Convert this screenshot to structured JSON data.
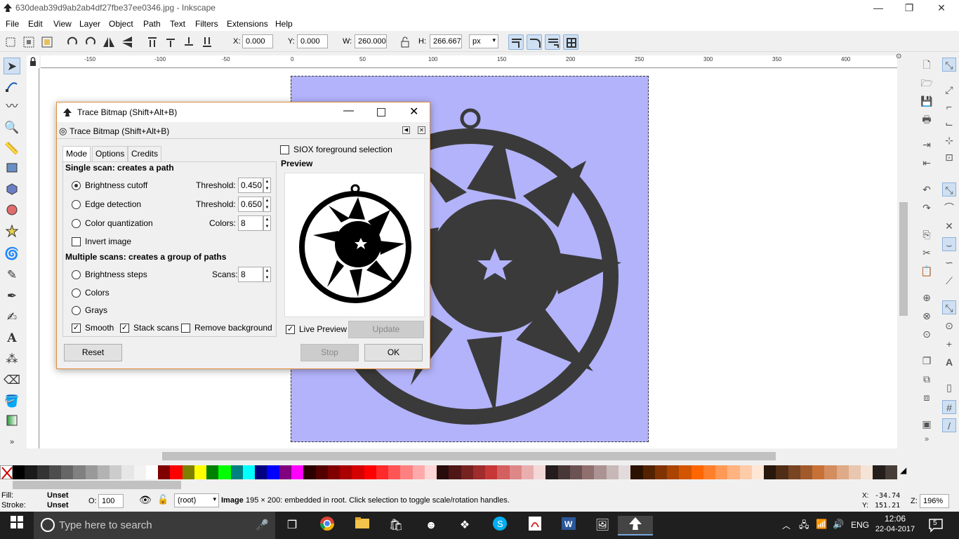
{
  "window": {
    "title": "630deab39d9ab2ab4df27fbe37ee0346.jpg - Inkscape",
    "minimize": "—",
    "maximize": "❐",
    "close": "✕"
  },
  "menu": [
    "File",
    "Edit",
    "View",
    "Layer",
    "Object",
    "Path",
    "Text",
    "Filters",
    "Extensions",
    "Help"
  ],
  "controls": {
    "x_label": "X:",
    "x_value": "0.000",
    "y_label": "Y:",
    "y_value": "0.000",
    "w_label": "W:",
    "w_value": "260.000",
    "h_label": "H:",
    "h_value": "266.667",
    "unit": "px"
  },
  "ruler": [
    "-150",
    "-100",
    "-50",
    "0",
    "50",
    "100",
    "150",
    "200",
    "250",
    "300",
    "350",
    "400",
    "450"
  ],
  "dialog": {
    "title": "Trace Bitmap (Shift+Alt+B)",
    "subtitle": "Trace Bitmap (Shift+Alt+B)",
    "tabs": [
      "Mode",
      "Options",
      "Credits"
    ],
    "single_scan_header": "Single scan: creates a path",
    "brightness_cutoff": "Brightness cutoff",
    "threshold_label": "Threshold:",
    "threshold1": "0.450",
    "edge_detection": "Edge detection",
    "threshold2": "0.650",
    "color_quantization": "Color quantization",
    "colors_label": "Colors:",
    "colors_value": "8",
    "invert_image": "Invert image",
    "multiple_scans_header": "Multiple scans: creates a group of paths",
    "brightness_steps": "Brightness steps",
    "scans_label": "Scans:",
    "scans_value": "8",
    "colors_option": "Colors",
    "grays_option": "Grays",
    "smooth": "Smooth",
    "stack_scans": "Stack scans",
    "remove_background": "Remove background",
    "siox": "SIOX foreground selection",
    "preview_label": "Preview",
    "live_preview": "Live Preview",
    "update": "Update",
    "reset": "Reset",
    "stop": "Stop",
    "ok": "OK"
  },
  "status": {
    "fill_label": "Fill:",
    "fill_value": "Unset",
    "stroke_label": "Stroke:",
    "stroke_value": "Unset",
    "opacity_label": "O:",
    "opacity_value": "100",
    "layer": "(root)",
    "message_bold": "Image",
    "message": " 195 × 200: embedded in root. Click selection to toggle scale/rotation handles.",
    "cursor_x_label": "X:",
    "cursor_x": "-34.74",
    "cursor_y_label": "Y:",
    "cursor_y": "151.21",
    "zoom_label": "Z:",
    "zoom": "196%"
  },
  "taskbar": {
    "search_placeholder": "Type here to search",
    "lang": "ENG",
    "time": "12:06",
    "date": "22-04-2017",
    "notifications": "5"
  },
  "palette_colors": [
    "#000000",
    "#1a1a1a",
    "#333333",
    "#4d4d4d",
    "#666666",
    "#808080",
    "#999999",
    "#b3b3b3",
    "#cccccc",
    "#e6e6e6",
    "#f2f2f2",
    "#ffffff",
    "#800000",
    "#ff0000",
    "#808000",
    "#ffff00",
    "#008000",
    "#00ff00",
    "#008080",
    "#00ffff",
    "#000080",
    "#0000ff",
    "#800080",
    "#ff00ff",
    "#2b0000",
    "#550000",
    "#800000",
    "#aa0000",
    "#d40000",
    "#ff0000",
    "#ff2a2a",
    "#ff5555",
    "#ff8080",
    "#ffaaaa",
    "#ffd5d5",
    "#280b0b",
    "#501616",
    "#782121",
    "#a02c2c",
    "#c83737",
    "#d35f5f",
    "#de8787",
    "#e9afaf",
    "#f4d7d7",
    "#241c1c",
    "#483737",
    "#6c5353",
    "#916f6f",
    "#ac9393",
    "#c8b7b7",
    "#e3dbdb",
    "#2b1100",
    "#552200",
    "#803300",
    "#aa4400",
    "#d45500",
    "#ff6600",
    "#ff7f2a",
    "#ff9955",
    "#ffb380",
    "#ffccaa",
    "#ffe6d5",
    "#28170b",
    "#502d16",
    "#784421",
    "#a05a2c",
    "#c87137",
    "#d38d5f",
    "#deaa87",
    "#e9c6af",
    "#f4e3d7",
    "#241f1c",
    "#483e37"
  ]
}
